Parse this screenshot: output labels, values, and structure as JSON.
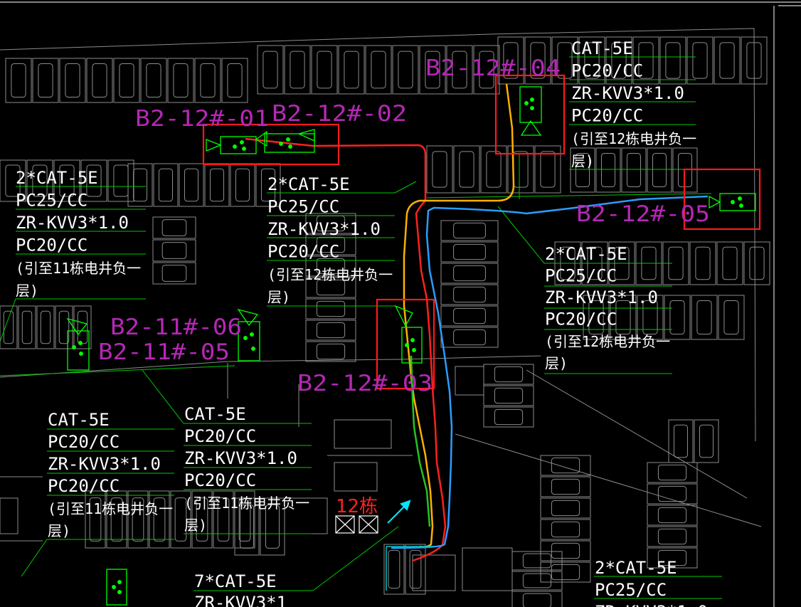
{
  "colors": {
    "background": "#000000",
    "parking_lines": "#8c8c8c",
    "text_white": "#ffffff",
    "leader_green": "#00c800",
    "device_green": "#00ff00",
    "label_magenta": "#b428b4",
    "highlight_red": "#ff1a1a",
    "route_red": "#ff2020",
    "route_orange": "#ffb000",
    "route_blue": "#2a9dff",
    "route_green": "#22c522",
    "route_cyan": "#00c8c8"
  },
  "device_labels": [
    {
      "id": "b2-12-01",
      "text": "B2-12#-01"
    },
    {
      "id": "b2-12-02",
      "text": "B2-12#-02"
    },
    {
      "id": "b2-12-04",
      "text": "B2-12#-04"
    },
    {
      "id": "b2-12-05",
      "text": "B2-12#-05"
    },
    {
      "id": "b2-11-06",
      "text": "B2-11#-06"
    },
    {
      "id": "b2-11-05",
      "text": "B2-11#-05"
    },
    {
      "id": "b2-12-03",
      "text": "B2-12#-03"
    }
  ],
  "cable_annotations": [
    {
      "id": "anno-01",
      "lines": [
        "2*CAT-5E",
        "PC25/CC",
        "ZR-KVV3*1.0",
        "PC20/CC",
        "(引至11栋电井负一",
        "层)"
      ]
    },
    {
      "id": "anno-02",
      "lines": [
        "2*CAT-5E",
        "PC25/CC",
        "ZR-KVV3*1.0",
        "PC20/CC",
        "(引至12栋电井负一",
        "层)"
      ]
    },
    {
      "id": "anno-04",
      "lines": [
        "CAT-5E",
        "PC20/CC",
        "ZR-KVV3*1.0",
        "PC20/CC",
        "(引至12栋电井负一",
        "层)"
      ]
    },
    {
      "id": "anno-05",
      "lines": [
        "2*CAT-5E",
        "PC25/CC",
        "ZR-KVV3*1.0",
        "PC20/CC",
        "(引至12栋电井负一",
        "层)"
      ]
    },
    {
      "id": "anno-11a",
      "lines": [
        "CAT-5E",
        "PC20/CC",
        "ZR-KVV3*1.0",
        "PC20/CC",
        "(引至11栋电井负一",
        "层)"
      ]
    },
    {
      "id": "anno-11b",
      "lines": [
        "CAT-5E",
        "PC20/CC",
        "ZR-KVV3*1.0",
        "PC20/CC",
        "(引至11栋电井负一",
        "层)"
      ]
    },
    {
      "id": "anno-bottom-left",
      "lines": [
        "7*CAT-5E",
        "ZR-KVV3*1"
      ]
    },
    {
      "id": "anno-bottom-right",
      "lines": [
        "2*CAT-5E",
        "PC25/CC",
        "ZR-KVV3*1.0"
      ]
    }
  ],
  "building_label": "12栋",
  "parking_letter": "B"
}
